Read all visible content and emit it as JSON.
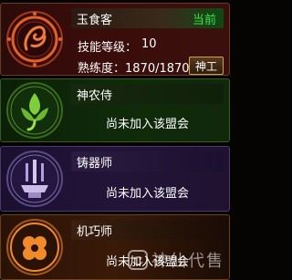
{
  "cards": [
    {
      "name": "玉食客",
      "status": "当前",
      "skill_label": "技能等级：",
      "skill_value": "10",
      "proficiency_label": "熟练度：1870/1870",
      "button_label": "神工",
      "colors": {
        "accent": "#36e34a",
        "emblem": "#e0612a"
      },
      "icon": "phoenix-emblem-icon"
    },
    {
      "name": "神农侍",
      "message": "尚未加入该盟会",
      "colors": {
        "emblem": "#7fcf3a"
      },
      "icon": "leaf-emblem-icon"
    },
    {
      "name": "铸器师",
      "message": "尚未加入该盟会",
      "colors": {
        "emblem": "#b0a0e0"
      },
      "icon": "forge-emblem-icon"
    },
    {
      "name": "机巧师",
      "message": "尚未加入该盟会",
      "colors": {
        "emblem": "#f08a2a"
      },
      "icon": "gear-emblem-icon"
    }
  ],
  "watermark": {
    "text": "神仙代售",
    "icon": "smile-logo-icon"
  }
}
